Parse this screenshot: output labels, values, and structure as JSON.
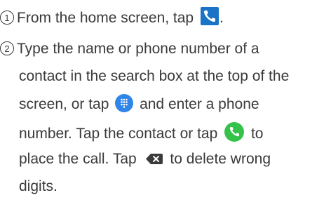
{
  "steps": [
    {
      "number": "1",
      "lines": [
        {
          "before": "From the home screen, tap ",
          "after": "."
        }
      ]
    },
    {
      "number": "2",
      "lines": [
        "Type the name or phone number of a",
        "contact in the search box at the top of the",
        {
          "before": "screen, or tap ",
          "after": " and enter a phone"
        },
        {
          "before": "number. Tap the contact or tap ",
          "after": " to"
        },
        {
          "before": "place the call. Tap ",
          "after": " to delete wrong"
        },
        "digits."
      ]
    }
  ],
  "icons": {
    "phone_app": "phone-app-icon",
    "dialpad": "dialpad-icon",
    "call": "call-icon",
    "delete": "delete-icon"
  },
  "colors": {
    "text": "#3a3a3a",
    "phone_app": "#1a73c6",
    "dialpad": "#2f86e6",
    "call": "#35c24a"
  }
}
